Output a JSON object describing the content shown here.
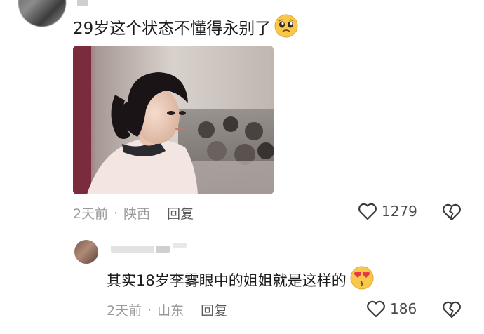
{
  "comment": {
    "text": "29岁这个状态不懂得永别了",
    "emoji": "pleading-face-icon",
    "time": "2天前",
    "location": "陕西",
    "separator": "·",
    "reply_label": "回复",
    "like_count": "1279"
  },
  "reply": {
    "text": "其实18岁李雾眼中的姐姐就是这样的",
    "emoji": "heart-eyes-kiss-icon",
    "time": "2天前",
    "location": "山东",
    "separator": "·",
    "reply_label": "回复",
    "like_count": "186"
  },
  "colors": {
    "text": "#1c1c1c",
    "meta": "#9a9a9a",
    "emoji_yellow": "#f7c84a",
    "heart_red": "#e8334a"
  }
}
